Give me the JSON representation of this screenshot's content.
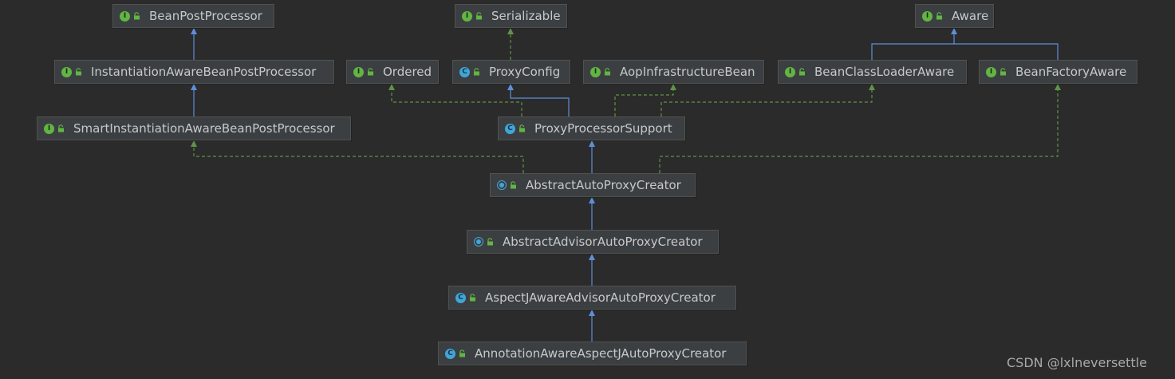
{
  "diagram": {
    "nodes": [
      {
        "id": "bpp",
        "label": "BeanPostProcessor",
        "kind": "interface"
      },
      {
        "id": "ser",
        "label": "Serializable",
        "kind": "interface"
      },
      {
        "id": "aware",
        "label": "Aware",
        "kind": "interface"
      },
      {
        "id": "iabpp",
        "label": "InstantiationAwareBeanPostProcessor",
        "kind": "interface"
      },
      {
        "id": "ordered",
        "label": "Ordered",
        "kind": "interface"
      },
      {
        "id": "proxycfg",
        "label": "ProxyConfig",
        "kind": "class"
      },
      {
        "id": "aopinfra",
        "label": "AopInfrastructureBean",
        "kind": "interface"
      },
      {
        "id": "bcla",
        "label": "BeanClassLoaderAware",
        "kind": "interface"
      },
      {
        "id": "bfa",
        "label": "BeanFactoryAware",
        "kind": "interface"
      },
      {
        "id": "siabpp",
        "label": "SmartInstantiationAwareBeanPostProcessor",
        "kind": "interface"
      },
      {
        "id": "pps",
        "label": "ProxyProcessorSupport",
        "kind": "class"
      },
      {
        "id": "aapc",
        "label": "AbstractAutoProxyCreator",
        "kind": "abstract-class"
      },
      {
        "id": "aadvapc",
        "label": "AbstractAdvisorAutoProxyCreator",
        "kind": "abstract-class"
      },
      {
        "id": "ajaapc",
        "label": "AspectJAwareAdvisorAutoProxyCreator",
        "kind": "class"
      },
      {
        "id": "aaajapc",
        "label": "AnnotationAwareAspectJAutoProxyCreator",
        "kind": "class"
      }
    ],
    "edges": [
      {
        "from": "iabpp",
        "to": "bpp",
        "type": "extends"
      },
      {
        "from": "siabpp",
        "to": "iabpp",
        "type": "extends"
      },
      {
        "from": "proxycfg",
        "to": "ser",
        "type": "implements"
      },
      {
        "from": "pps",
        "to": "proxycfg",
        "type": "extends"
      },
      {
        "from": "pps",
        "to": "ordered",
        "type": "implements"
      },
      {
        "from": "pps",
        "to": "aopinfra",
        "type": "implements"
      },
      {
        "from": "pps",
        "to": "bcla",
        "type": "implements"
      },
      {
        "from": "bcla",
        "to": "aware",
        "type": "extends"
      },
      {
        "from": "bfa",
        "to": "aware",
        "type": "extends"
      },
      {
        "from": "aapc",
        "to": "pps",
        "type": "extends"
      },
      {
        "from": "aapc",
        "to": "siabpp",
        "type": "implements"
      },
      {
        "from": "aapc",
        "to": "bfa",
        "type": "implements"
      },
      {
        "from": "aadvapc",
        "to": "aapc",
        "type": "extends"
      },
      {
        "from": "ajaapc",
        "to": "aadvapc",
        "type": "extends"
      },
      {
        "from": "aaajapc",
        "to": "ajaapc",
        "type": "extends"
      }
    ]
  },
  "watermark": "CSDN @lxlneversettle",
  "colors": {
    "background": "#2b2b2b",
    "node_fill": "#3c3f41",
    "node_border": "#515151",
    "text": "#c6c8ca",
    "interface_badge": "#62b543",
    "class_badge": "#40a6d9",
    "extends_edge": "#5e8fd9",
    "interface_edge": "#5f9348"
  },
  "icons": {
    "interface": "interface-badge-icon",
    "class": "class-badge-icon",
    "abstract-class": "abstract-class-badge-icon",
    "visibility": "public-lock-icon"
  }
}
